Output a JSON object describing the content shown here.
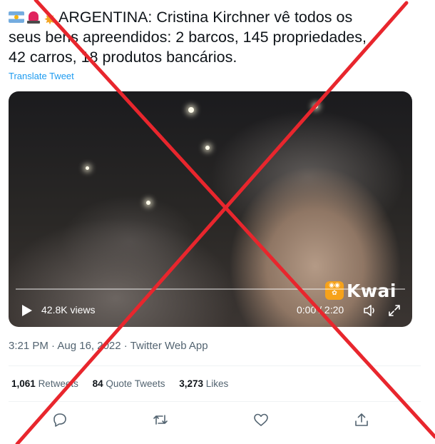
{
  "tweet": {
    "emoji": [
      "argentina-flag",
      "police-light",
      "collision"
    ],
    "text_line1": "ARGENTINA: Cristina Kirchner vê todos os",
    "text_line2": "seus bens apreendidos: 2 barcos, 145 propriedades,",
    "text_line3": "42 carros, 18 produtos bancários.",
    "translate": "Translate Tweet",
    "timestamp": "3:21 PM · Aug 16, 2022 · Twitter Web App"
  },
  "video": {
    "views": "42.8K views",
    "time": "0:00 / 2:20",
    "watermark": "Kwai",
    "progress": 0
  },
  "stats": {
    "retweets_count": "1,061",
    "retweets_label": "Retweets",
    "quotes_count": "84",
    "quotes_label": "Quote Tweets",
    "likes_count": "3,273",
    "likes_label": "Likes"
  },
  "actions": [
    "reply-icon",
    "retweet-icon",
    "like-icon",
    "share-icon"
  ],
  "overlay": {
    "mark": "red-x-cross",
    "color": "#e8262d"
  }
}
